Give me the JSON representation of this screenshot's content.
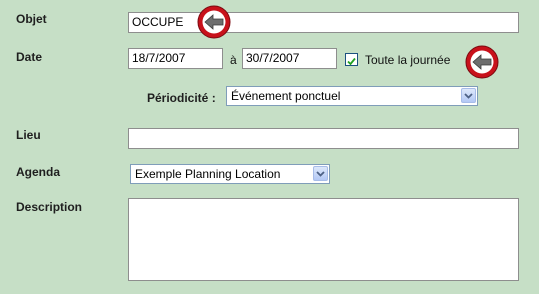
{
  "form": {
    "objet": {
      "label": "Objet",
      "value": "OCCUPE"
    },
    "date": {
      "label": "Date",
      "start": "18/7/2007",
      "separator": "à",
      "end": "30/7/2007",
      "all_day": {
        "label": "Toute la journée",
        "checked": true
      }
    },
    "periodicite": {
      "label": "Périodicité :",
      "value": "Événement ponctuel"
    },
    "lieu": {
      "label": "Lieu",
      "value": ""
    },
    "agenda": {
      "label": "Agenda",
      "value": "Exemple Planning Location"
    },
    "description": {
      "label": "Description",
      "value": ""
    }
  },
  "icons": {
    "arrow": "red-circle-left-arrow-icon"
  },
  "colors": {
    "background": "#c6dfc6",
    "arrow_ring": "#c8111b",
    "arrow_fill": "#6e6e6e"
  }
}
